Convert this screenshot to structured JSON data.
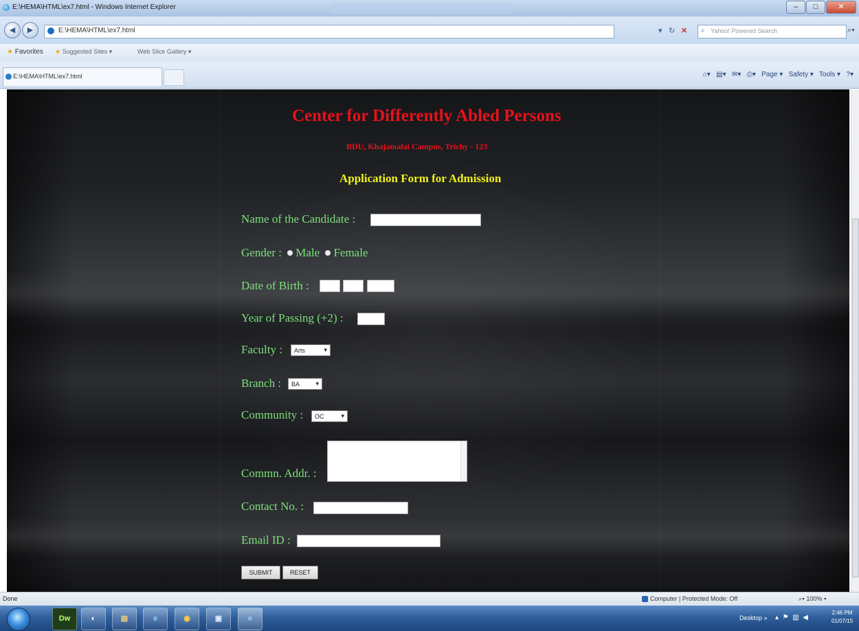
{
  "window": {
    "title": "E:\\HEMA\\HTML\\ex7.html - Windows Internet Explorer",
    "controls": [
      "–",
      "□",
      "✕"
    ]
  },
  "address": {
    "url": "E:\\HEMA\\HTML\\ex7.html",
    "search_placeholder": "Yahoo! Powered Search"
  },
  "favorites": {
    "label": "Favorites",
    "links": [
      "Suggested Sites ▾",
      "Web Slice Gallery ▾"
    ]
  },
  "tab": {
    "label": "E:\\HEMA\\HTML\\ex7.html"
  },
  "commandbar": {
    "page": "Page ▾",
    "safety": "Safety ▾",
    "tools": "Tools ▾"
  },
  "page": {
    "heading": "Center for Differently Abled Persons",
    "subheading": "BDU, Khajamalai Campus, Trichy - 123",
    "form_title": "Application Form for Admission",
    "labels": {
      "name": "Name of the Candidate :",
      "gender": "Gender :",
      "gender_male": "Male",
      "gender_female": "Female",
      "dob": "Date of Birth :",
      "yop": "Year of Passing (+2) :",
      "faculty": "Faculty :",
      "branch": "Branch :",
      "community": "Community :",
      "address": "Commn. Addr. :",
      "contact": "Contact No. :",
      "email": "Email ID :"
    },
    "values": {
      "faculty": "Arts",
      "branch": "BA",
      "community": "OC"
    },
    "buttons": {
      "submit": "SUBMIT",
      "reset": "RESET"
    }
  },
  "status": {
    "left": "Done",
    "zone": "Computer | Protected Mode: Off",
    "zoom": "100%"
  },
  "taskbar": {
    "desktop": "Desktop",
    "time": "2:46 PM",
    "date": "01/07/15",
    "apps": [
      "Dw",
      "◐",
      "▤",
      "e",
      "◉",
      "▣",
      "e"
    ]
  }
}
